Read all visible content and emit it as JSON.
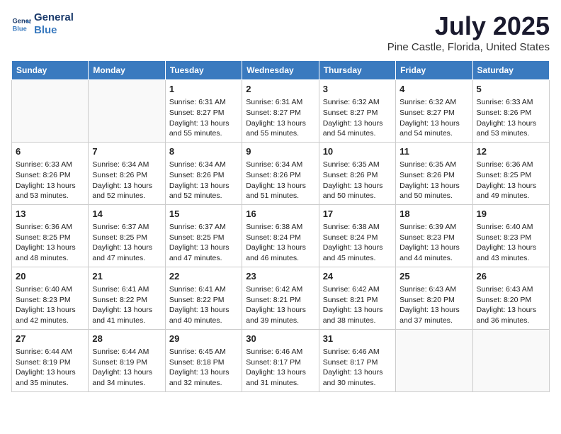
{
  "logo": {
    "line1": "General",
    "line2": "Blue"
  },
  "title": "July 2025",
  "subtitle": "Pine Castle, Florida, United States",
  "weekdays": [
    "Sunday",
    "Monday",
    "Tuesday",
    "Wednesday",
    "Thursday",
    "Friday",
    "Saturday"
  ],
  "weeks": [
    [
      {
        "day": "",
        "sunrise": "",
        "sunset": "",
        "daylight": ""
      },
      {
        "day": "",
        "sunrise": "",
        "sunset": "",
        "daylight": ""
      },
      {
        "day": "1",
        "sunrise": "Sunrise: 6:31 AM",
        "sunset": "Sunset: 8:27 PM",
        "daylight": "Daylight: 13 hours and 55 minutes."
      },
      {
        "day": "2",
        "sunrise": "Sunrise: 6:31 AM",
        "sunset": "Sunset: 8:27 PM",
        "daylight": "Daylight: 13 hours and 55 minutes."
      },
      {
        "day": "3",
        "sunrise": "Sunrise: 6:32 AM",
        "sunset": "Sunset: 8:27 PM",
        "daylight": "Daylight: 13 hours and 54 minutes."
      },
      {
        "day": "4",
        "sunrise": "Sunrise: 6:32 AM",
        "sunset": "Sunset: 8:27 PM",
        "daylight": "Daylight: 13 hours and 54 minutes."
      },
      {
        "day": "5",
        "sunrise": "Sunrise: 6:33 AM",
        "sunset": "Sunset: 8:26 PM",
        "daylight": "Daylight: 13 hours and 53 minutes."
      }
    ],
    [
      {
        "day": "6",
        "sunrise": "Sunrise: 6:33 AM",
        "sunset": "Sunset: 8:26 PM",
        "daylight": "Daylight: 13 hours and 53 minutes."
      },
      {
        "day": "7",
        "sunrise": "Sunrise: 6:34 AM",
        "sunset": "Sunset: 8:26 PM",
        "daylight": "Daylight: 13 hours and 52 minutes."
      },
      {
        "day": "8",
        "sunrise": "Sunrise: 6:34 AM",
        "sunset": "Sunset: 8:26 PM",
        "daylight": "Daylight: 13 hours and 52 minutes."
      },
      {
        "day": "9",
        "sunrise": "Sunrise: 6:34 AM",
        "sunset": "Sunset: 8:26 PM",
        "daylight": "Daylight: 13 hours and 51 minutes."
      },
      {
        "day": "10",
        "sunrise": "Sunrise: 6:35 AM",
        "sunset": "Sunset: 8:26 PM",
        "daylight": "Daylight: 13 hours and 50 minutes."
      },
      {
        "day": "11",
        "sunrise": "Sunrise: 6:35 AM",
        "sunset": "Sunset: 8:26 PM",
        "daylight": "Daylight: 13 hours and 50 minutes."
      },
      {
        "day": "12",
        "sunrise": "Sunrise: 6:36 AM",
        "sunset": "Sunset: 8:25 PM",
        "daylight": "Daylight: 13 hours and 49 minutes."
      }
    ],
    [
      {
        "day": "13",
        "sunrise": "Sunrise: 6:36 AM",
        "sunset": "Sunset: 8:25 PM",
        "daylight": "Daylight: 13 hours and 48 minutes."
      },
      {
        "day": "14",
        "sunrise": "Sunrise: 6:37 AM",
        "sunset": "Sunset: 8:25 PM",
        "daylight": "Daylight: 13 hours and 47 minutes."
      },
      {
        "day": "15",
        "sunrise": "Sunrise: 6:37 AM",
        "sunset": "Sunset: 8:25 PM",
        "daylight": "Daylight: 13 hours and 47 minutes."
      },
      {
        "day": "16",
        "sunrise": "Sunrise: 6:38 AM",
        "sunset": "Sunset: 8:24 PM",
        "daylight": "Daylight: 13 hours and 46 minutes."
      },
      {
        "day": "17",
        "sunrise": "Sunrise: 6:38 AM",
        "sunset": "Sunset: 8:24 PM",
        "daylight": "Daylight: 13 hours and 45 minutes."
      },
      {
        "day": "18",
        "sunrise": "Sunrise: 6:39 AM",
        "sunset": "Sunset: 8:23 PM",
        "daylight": "Daylight: 13 hours and 44 minutes."
      },
      {
        "day": "19",
        "sunrise": "Sunrise: 6:40 AM",
        "sunset": "Sunset: 8:23 PM",
        "daylight": "Daylight: 13 hours and 43 minutes."
      }
    ],
    [
      {
        "day": "20",
        "sunrise": "Sunrise: 6:40 AM",
        "sunset": "Sunset: 8:23 PM",
        "daylight": "Daylight: 13 hours and 42 minutes."
      },
      {
        "day": "21",
        "sunrise": "Sunrise: 6:41 AM",
        "sunset": "Sunset: 8:22 PM",
        "daylight": "Daylight: 13 hours and 41 minutes."
      },
      {
        "day": "22",
        "sunrise": "Sunrise: 6:41 AM",
        "sunset": "Sunset: 8:22 PM",
        "daylight": "Daylight: 13 hours and 40 minutes."
      },
      {
        "day": "23",
        "sunrise": "Sunrise: 6:42 AM",
        "sunset": "Sunset: 8:21 PM",
        "daylight": "Daylight: 13 hours and 39 minutes."
      },
      {
        "day": "24",
        "sunrise": "Sunrise: 6:42 AM",
        "sunset": "Sunset: 8:21 PM",
        "daylight": "Daylight: 13 hours and 38 minutes."
      },
      {
        "day": "25",
        "sunrise": "Sunrise: 6:43 AM",
        "sunset": "Sunset: 8:20 PM",
        "daylight": "Daylight: 13 hours and 37 minutes."
      },
      {
        "day": "26",
        "sunrise": "Sunrise: 6:43 AM",
        "sunset": "Sunset: 8:20 PM",
        "daylight": "Daylight: 13 hours and 36 minutes."
      }
    ],
    [
      {
        "day": "27",
        "sunrise": "Sunrise: 6:44 AM",
        "sunset": "Sunset: 8:19 PM",
        "daylight": "Daylight: 13 hours and 35 minutes."
      },
      {
        "day": "28",
        "sunrise": "Sunrise: 6:44 AM",
        "sunset": "Sunset: 8:19 PM",
        "daylight": "Daylight: 13 hours and 34 minutes."
      },
      {
        "day": "29",
        "sunrise": "Sunrise: 6:45 AM",
        "sunset": "Sunset: 8:18 PM",
        "daylight": "Daylight: 13 hours and 32 minutes."
      },
      {
        "day": "30",
        "sunrise": "Sunrise: 6:46 AM",
        "sunset": "Sunset: 8:17 PM",
        "daylight": "Daylight: 13 hours and 31 minutes."
      },
      {
        "day": "31",
        "sunrise": "Sunrise: 6:46 AM",
        "sunset": "Sunset: 8:17 PM",
        "daylight": "Daylight: 13 hours and 30 minutes."
      },
      {
        "day": "",
        "sunrise": "",
        "sunset": "",
        "daylight": ""
      },
      {
        "day": "",
        "sunrise": "",
        "sunset": "",
        "daylight": ""
      }
    ]
  ]
}
